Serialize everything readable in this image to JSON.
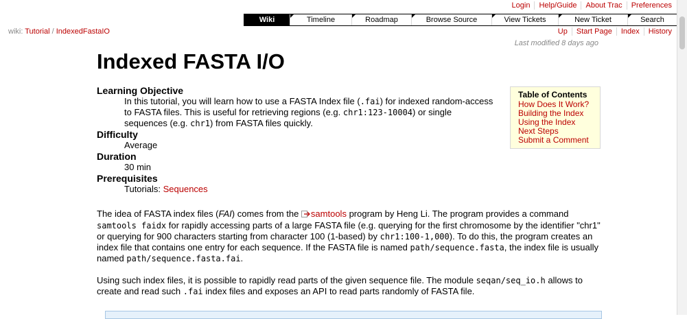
{
  "metanav": [
    "Login",
    "Help/Guide",
    "About Trac",
    "Preferences"
  ],
  "mainnav": {
    "active": "Wiki",
    "tabs": [
      "Timeline",
      "Roadmap",
      "Browse Source",
      "View Tickets",
      "New Ticket",
      "Search"
    ]
  },
  "breadcrumb": {
    "prefix": "wiki:",
    "items": [
      "Tutorial",
      "IndexedFastaIO"
    ],
    "separator": "/"
  },
  "ctxtnav": [
    "Up",
    "Start Page",
    "Index",
    "History"
  ],
  "last_modified": "Last modified 8 days ago",
  "title": "Indexed FASTA I/O",
  "objective": {
    "label": "Learning Objective",
    "t1": "In this tutorial, you will learn how to use a FASTA Index file (",
    "c1": ".fai",
    "t2": ") for indexed random-access to FASTA files. This is useful for retrieving regions (e.g. ",
    "c2": "chr1:123-10004",
    "t3": ") or single sequences (e.g. ",
    "c3": "chr1",
    "t4": ") from FASTA files quickly."
  },
  "difficulty": {
    "label": "Difficulty",
    "value": "Average"
  },
  "duration": {
    "label": "Duration",
    "value": "30 min"
  },
  "prerequisites": {
    "label": "Prerequisites",
    "prefix": "Tutorials:",
    "link": "Sequences"
  },
  "toc": {
    "title": "Table of Contents",
    "items": [
      "How Does It Work?",
      "Building the Index",
      "Using the Index",
      "Next Steps",
      "Submit a Comment"
    ]
  },
  "para1": {
    "t1": "The idea of FASTA index files (",
    "em1": "FAI",
    "t2": ") comes from the ",
    "link": "samtools",
    "t3": " program by Heng Li. The program provides a command ",
    "c1": "samtools faidx",
    "t4": " for rapidly accessing parts of a large FASTA file (e.g. querying for the first chromosome by the identifier \"chr1\" or querying for 900 characters starting from character 100 (1-based) by ",
    "c2": "chr1:100-1,000",
    "t5": "). To do this, the program creates an index file that contains one entry for each sequence. If the FASTA file is named ",
    "c3": "path/sequence.fasta",
    "t6": ", the index file is usually named ",
    "c4": "path/sequence.fasta.fai",
    "t7": "."
  },
  "para2": {
    "t1": "Using such index files, it is possible to rapidly read parts of the given sequence file. The module ",
    "c1": "seqan/seq_io.h",
    "t2": " allows to create and read such ",
    "c2": ".fai",
    "t3": " index files and exposes an API to read parts randomly of FASTA file."
  }
}
